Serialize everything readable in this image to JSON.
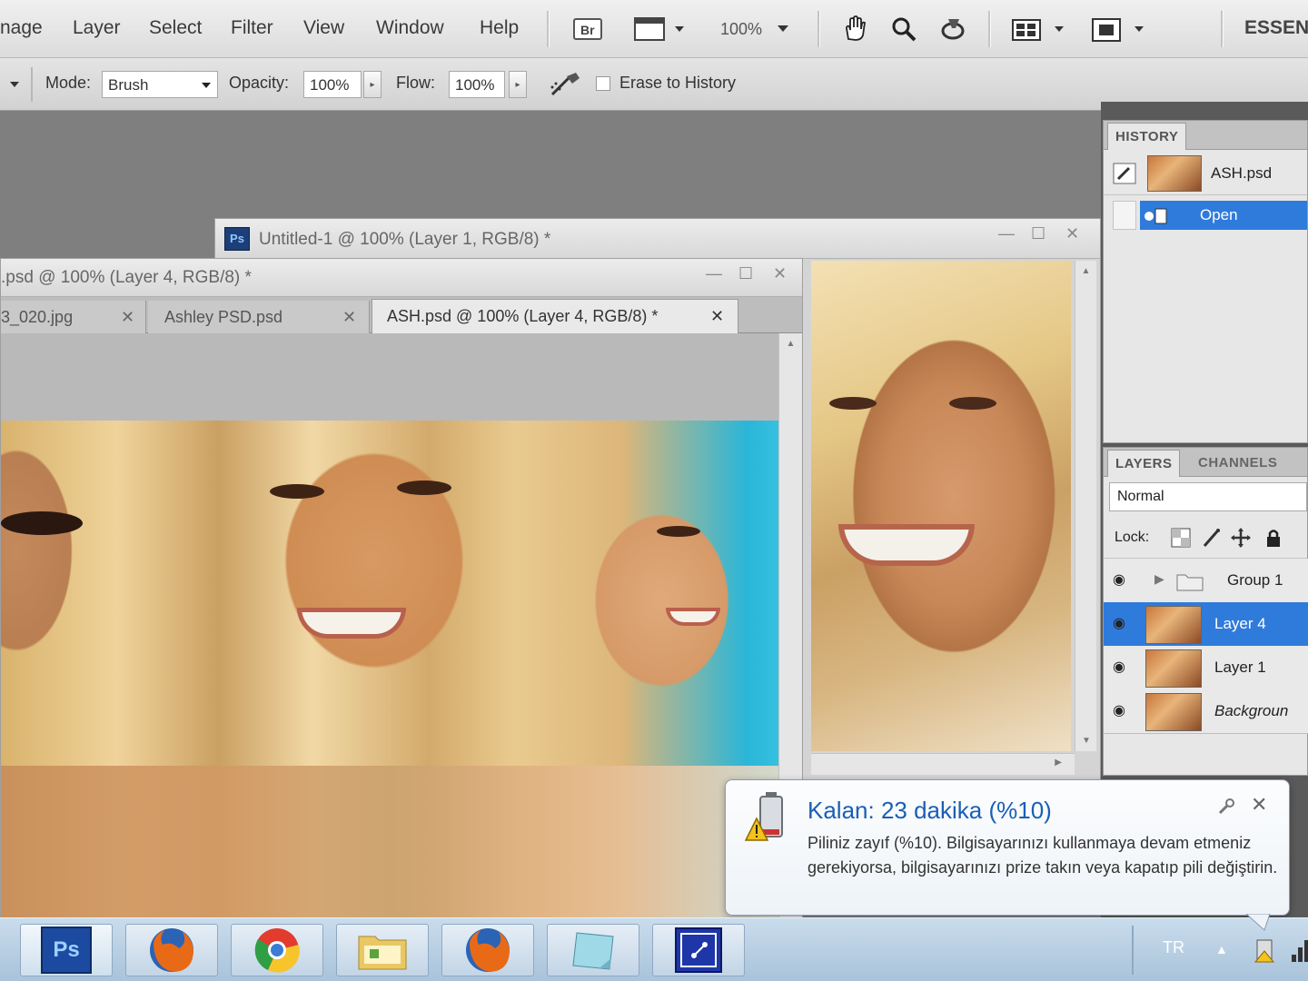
{
  "menubar": {
    "items": [
      "nage",
      "Layer",
      "Select",
      "Filter",
      "View",
      "Window",
      "Help"
    ],
    "zoom": "100%",
    "workspace_label": "ESSEN"
  },
  "options": {
    "mode_label": "Mode:",
    "mode_value": "Brush",
    "opacity_label": "Opacity:",
    "opacity_value": "100%",
    "flow_label": "Flow:",
    "flow_value": "100%",
    "erase_history_label": "Erase to History"
  },
  "documents": {
    "untitled_title": "Untitled-1 @ 100% (Layer 1, RGB/8) *",
    "back_title": ".psd @ 100% (Layer 4, RGB/8) *",
    "tabs": [
      {
        "label": "3_020.jpg"
      },
      {
        "label": "Ashley PSD.psd"
      },
      {
        "label": "ASH.psd @ 100% (Layer 4, RGB/8) *"
      }
    ]
  },
  "history": {
    "tab_label": "HISTORY",
    "snapshot_label": "ASH.psd",
    "items": [
      {
        "label": "Open"
      }
    ]
  },
  "layers": {
    "tabs": [
      "LAYERS",
      "CHANNELS"
    ],
    "blend_mode": "Normal",
    "lock_label": "Lock:",
    "rows": [
      {
        "name": "Group 1"
      },
      {
        "name": "Layer 4"
      },
      {
        "name": "Layer 1"
      },
      {
        "name": "Backgroun"
      }
    ]
  },
  "notification": {
    "title": "Kalan: 23 dakika (%10)",
    "body": "Piliniz zayıf (%10). Bilgisayarınızı kullanmaya devam etmeniz gerekiyorsa, bilgisayarınızı prize takın veya kapatıp pili değiştirin."
  },
  "taskbar": {
    "ps_label": "Ps",
    "language": "TR"
  }
}
